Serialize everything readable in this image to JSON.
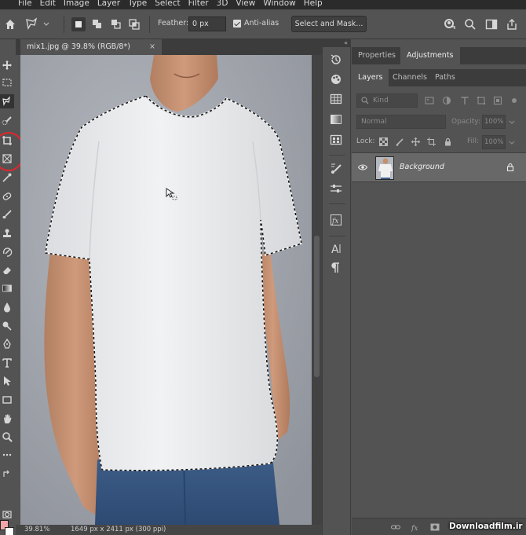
{
  "menu": {
    "items": [
      "File",
      "Edit",
      "Image",
      "Layer",
      "Type",
      "Select",
      "Filter",
      "3D",
      "View",
      "Window",
      "Help"
    ]
  },
  "options": {
    "feather_label": "Feather:",
    "feather_value": "0 px",
    "antialias_label": "Anti-alias",
    "antialias_checked": true,
    "select_and_mask": "Select and Mask..."
  },
  "document": {
    "tab_title": "mix1.jpg @ 39.8% (RGB/8*)",
    "close_glyph": "×",
    "zoom": "39.81%",
    "dimensions": "1649 px x 2411 px (300 ppi)"
  },
  "collapse_glyph": "«",
  "panels": {
    "top_tabs": [
      "Properties",
      "Adjustments"
    ],
    "top_active": "Adjustments",
    "layer_tabs": [
      "Layers",
      "Channels",
      "Paths"
    ],
    "layer_active": "Layers",
    "kind_placeholder": "Kind",
    "blend_mode": "Normal",
    "opacity_label": "Opacity:",
    "opacity_value": "100%",
    "lock_label": "Lock:",
    "fill_label": "Fill:",
    "fill_value": "100%",
    "layers": [
      {
        "name": "Background",
        "visible": true,
        "locked": true
      }
    ]
  },
  "watermark": "Downloadfilm.ir",
  "colors": {
    "foreground": "#f2a5a8",
    "background": "#ffffff",
    "highlight_circle": "#e2272c",
    "canvas_bg": "#a2a5ac"
  },
  "icons": {
    "toolbar": [
      "move-icon",
      "marquee-icon",
      "lasso-icon",
      "quick-selection-icon",
      "crop-icon",
      "frame-icon",
      "eyedropper-icon",
      "healing-icon",
      "brush-icon",
      "stamp-icon",
      "history-brush-icon",
      "eraser-icon",
      "gradient-icon",
      "blur-icon",
      "dodge-icon",
      "pen-icon",
      "type-icon",
      "path-selection-icon",
      "rectangle-icon",
      "hand-icon",
      "zoom-icon",
      "more-icon"
    ]
  }
}
